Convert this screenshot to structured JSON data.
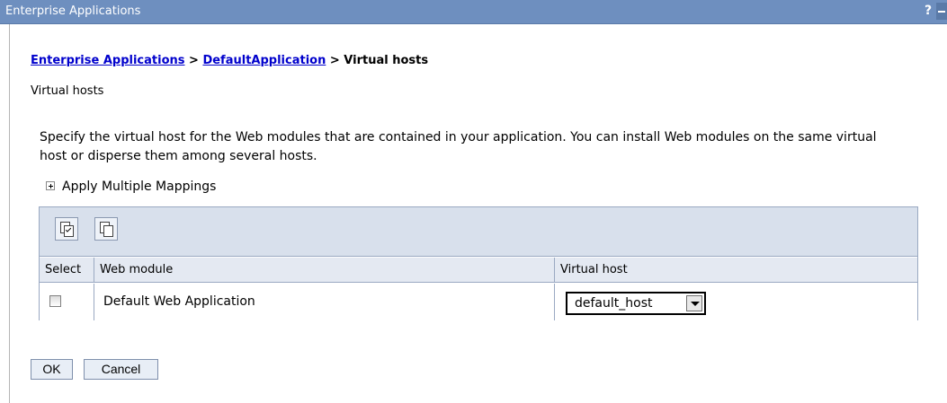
{
  "window": {
    "title": "Enterprise Applications",
    "help_label": "?"
  },
  "breadcrumb": {
    "items": [
      "Enterprise Applications",
      "DefaultApplication"
    ],
    "separator": " > ",
    "current": "Virtual hosts"
  },
  "page": {
    "subtitle": "Virtual hosts",
    "description": "Specify the virtual host for the Web modules that are contained in your application. You can install Web modules on the same virtual host or disperse them among several hosts.",
    "apply_multiple": "Apply Multiple Mappings"
  },
  "table": {
    "headers": [
      "Select",
      "Web module",
      "Virtual host"
    ],
    "rows": [
      {
        "selected": false,
        "web_module": "Default Web Application",
        "virtual_host": "default_host"
      }
    ]
  },
  "buttons": {
    "ok": "OK",
    "cancel": "Cancel"
  },
  "colors": {
    "titlebar": "#6e8fbf",
    "toolbar": "#d8e0ec",
    "header": "#e4e9f2",
    "link": "#0000cc"
  },
  "icons": [
    "select-all-icon",
    "deselect-all-icon",
    "expand-icon",
    "dropdown-arrow-icon",
    "minimize-icon"
  ]
}
